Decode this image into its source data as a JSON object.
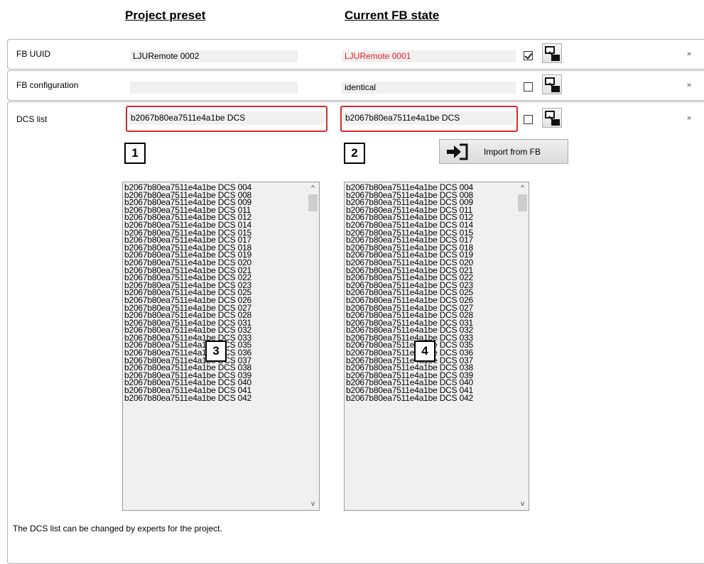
{
  "headers": {
    "project_preset": "Project preset",
    "current_fb_state": "Current FB state"
  },
  "rows": {
    "fb_uuid": {
      "label": "FB UUID",
      "preset_value": "LJURemote 0002",
      "current_value": "LJURemote 0001",
      "current_color": "#e02020",
      "checked": true,
      "chevron": "double-chevron-down"
    },
    "fb_configuration": {
      "label": "FB configuration",
      "preset_value": "",
      "current_value": "identical",
      "checked": false,
      "chevron": "double-chevron-down"
    },
    "dcs_list": {
      "label": "DCS list",
      "preset_value": "b2067b80ea7511e4a1be DCS",
      "current_value": "b2067b80ea7511e4a1be DCS",
      "checked": false,
      "chevron": "double-chevron-up"
    }
  },
  "markers": [
    "1",
    "2",
    "3",
    "4"
  ],
  "import_button": {
    "label": "Import from FB",
    "icon": "import-arrow-icon"
  },
  "preset_list": [
    "b2067b80ea7511e4a1be DCS 004",
    "b2067b80ea7511e4a1be DCS 008",
    "b2067b80ea7511e4a1be DCS 009",
    "b2067b80ea7511e4a1be DCS 011",
    "b2067b80ea7511e4a1be DCS 012",
    "b2067b80ea7511e4a1be DCS 014",
    "b2067b80ea7511e4a1be DCS 015",
    "b2067b80ea7511e4a1be DCS 017",
    "b2067b80ea7511e4a1be DCS 018",
    "b2067b80ea7511e4a1be DCS 019",
    "b2067b80ea7511e4a1be DCS 020",
    "b2067b80ea7511e4a1be DCS 021",
    "b2067b80ea7511e4a1be DCS 022",
    "b2067b80ea7511e4a1be DCS 023",
    "b2067b80ea7511e4a1be DCS 025",
    "b2067b80ea7511e4a1be DCS 026",
    "b2067b80ea7511e4a1be DCS 027",
    "b2067b80ea7511e4a1be DCS 028",
    "b2067b80ea7511e4a1be DCS 031",
    "b2067b80ea7511e4a1be DCS 032",
    "b2067b80ea7511e4a1be DCS 033",
    "b2067b80ea7511e4a1be DCS 035",
    "b2067b80ea7511e4a1be DCS 036",
    "b2067b80ea7511e4a1be DCS 037",
    "b2067b80ea7511e4a1be DCS 038",
    "b2067b80ea7511e4a1be DCS 039",
    "b2067b80ea7511e4a1be DCS 040",
    "b2067b80ea7511e4a1be DCS 041",
    "b2067b80ea7511e4a1be DCS 042"
  ],
  "current_list": [
    "b2067b80ea7511e4a1be DCS 004",
    "b2067b80ea7511e4a1be DCS 008",
    "b2067b80ea7511e4a1be DCS 009",
    "b2067b80ea7511e4a1be DCS 011",
    "b2067b80ea7511e4a1be DCS 012",
    "b2067b80ea7511e4a1be DCS 014",
    "b2067b80ea7511e4a1be DCS 015",
    "b2067b80ea7511e4a1be DCS 017",
    "b2067b80ea7511e4a1be DCS 018",
    "b2067b80ea7511e4a1be DCS 019",
    "b2067b80ea7511e4a1be DCS 020",
    "b2067b80ea7511e4a1be DCS 021",
    "b2067b80ea7511e4a1be DCS 022",
    "b2067b80ea7511e4a1be DCS 023",
    "b2067b80ea7511e4a1be DCS 025",
    "b2067b80ea7511e4a1be DCS 026",
    "b2067b80ea7511e4a1be DCS 027",
    "b2067b80ea7511e4a1be DCS 028",
    "b2067b80ea7511e4a1be DCS 031",
    "b2067b80ea7511e4a1be DCS 032",
    "b2067b80ea7511e4a1be DCS 033",
    "b2067b80ea7511e4a1be DCS 035",
    "b2067b80ea7511e4a1be DCS 036",
    "b2067b80ea7511e4a1be DCS 037",
    "b2067b80ea7511e4a1be DCS 038",
    "b2067b80ea7511e4a1be DCS 039",
    "b2067b80ea7511e4a1be DCS 040",
    "b2067b80ea7511e4a1be DCS 041",
    "b2067b80ea7511e4a1be DCS 042"
  ],
  "scroll_icons": {
    "up": "^",
    "down": "v"
  },
  "footer_text": "The DCS list can be changed by experts for the project."
}
